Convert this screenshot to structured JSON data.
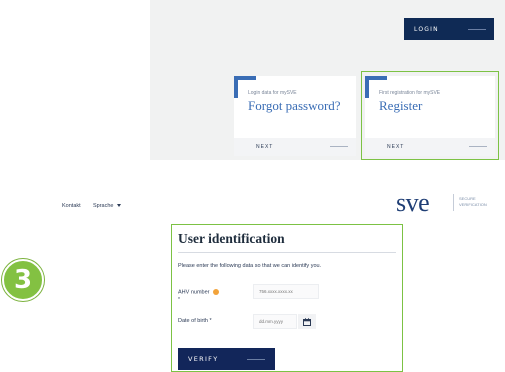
{
  "header": {
    "login_label": "LOGIN"
  },
  "cards": [
    {
      "caption": "Login data for mySVE",
      "title": "Forgot password?",
      "next_label": "NEXT"
    },
    {
      "caption": "First registration for mySVE",
      "title": "Register",
      "next_label": "NEXT"
    }
  ],
  "nav": {
    "contact": "Kontakt",
    "language": "Sprache"
  },
  "logo": {
    "text": "sve",
    "sub_line1": "SECURE",
    "sub_line2": "VERIFICATION"
  },
  "step": {
    "number": "3"
  },
  "form": {
    "title": "User identification",
    "instruction": "Please enter the following data so that we can identify you.",
    "ahv_label": "AHV number",
    "ahv_required_mark": "*",
    "ahv_placeholder": "756.xxxx.xxxx.xx",
    "dob_label": "Date of birth *",
    "dob_placeholder": "dd.mm.yyyy",
    "verify_label": "VERIFY"
  },
  "colors": {
    "navy": "#12265a",
    "accent_blue": "#3a6db5",
    "highlight_green": "#7cc244",
    "step_green": "#83c142",
    "info_orange": "#f2a33a"
  }
}
